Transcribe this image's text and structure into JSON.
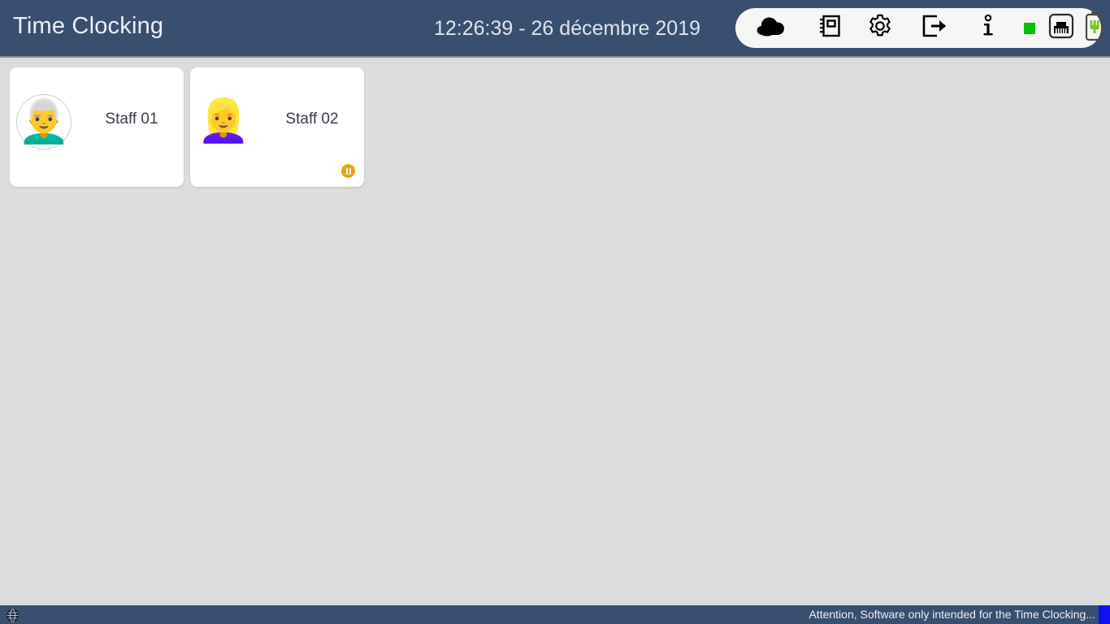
{
  "header": {
    "title": "Time Clocking",
    "datetime": "12:26:39 - 26 décembre 2019",
    "background_color": "#394f70",
    "title_color": "#eceff4"
  },
  "toolbar": {
    "background_color": "#f6f6f6",
    "items": [
      {
        "name": "cloud-icon",
        "label": "Cloud"
      },
      {
        "name": "notebook-icon",
        "label": "Notebook"
      },
      {
        "name": "gear-icon",
        "label": "Settings"
      },
      {
        "name": "logout-icon",
        "label": "Logout"
      },
      {
        "name": "info-icon",
        "label": "Information"
      },
      {
        "name": "status-led-indicator",
        "label": "Online",
        "color": "#00c000"
      },
      {
        "name": "ethernet-icon",
        "label": "Network"
      },
      {
        "name": "battery-icon",
        "label": "Power",
        "color": "#7ac70c"
      }
    ]
  },
  "content": {
    "background_color": "#dcdcdc",
    "staff_cards": [
      {
        "name": "Staff 01",
        "avatar": "older-man-avatar",
        "avatar_glyph": "👨‍🦳",
        "avatar_dotted_border": true,
        "status_badge": null
      },
      {
        "name": "Staff 02",
        "avatar": "blonde-woman-avatar",
        "avatar_glyph": "👱‍♀️",
        "avatar_dotted_border": false,
        "status_badge": "paused"
      }
    ]
  },
  "statusbar": {
    "globe_icon": "www-globe-icon",
    "message": "Attention, Software only intended for the  Time Clocking...",
    "background_color": "#394f70",
    "accent_color": "#1010f0"
  }
}
